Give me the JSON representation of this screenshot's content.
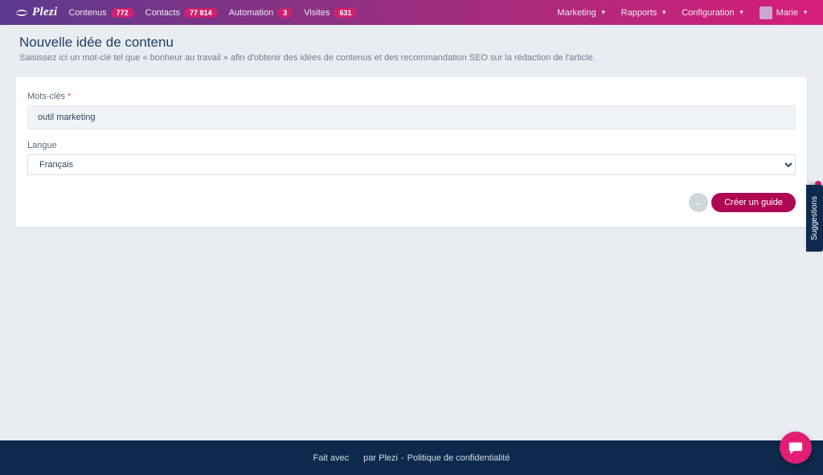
{
  "brand": {
    "name": "Plezi"
  },
  "nav": {
    "left": [
      {
        "label": "Contenus",
        "badge": "772"
      },
      {
        "label": "Contacts",
        "badge": "77 814"
      },
      {
        "label": "Automation",
        "badge": "3"
      },
      {
        "label": "Visites",
        "badge": "631"
      }
    ],
    "right": [
      {
        "label": "Marketing"
      },
      {
        "label": "Rapports"
      },
      {
        "label": "Configuration"
      }
    ],
    "user": {
      "name": "Marie"
    }
  },
  "page": {
    "title": "Nouvelle idée de contenu",
    "subtitle": "Saisissez ici un mot-clé tel que « bonheur au travail » afin d'obtenir des idées de contenus et des recommandation SEO sur la rédaction de l'article."
  },
  "form": {
    "keyword_label": "Mots-clés",
    "keyword_value": "outil marketing",
    "language_label": "Langue",
    "language_value": "Français",
    "submit_label": "Créer un guide"
  },
  "suggestions_tab": "Suggestions",
  "footer": {
    "made_with": "Fait avec",
    "by": "par Plezi",
    "sep": "-",
    "privacy": "Politique de confidentialité"
  }
}
